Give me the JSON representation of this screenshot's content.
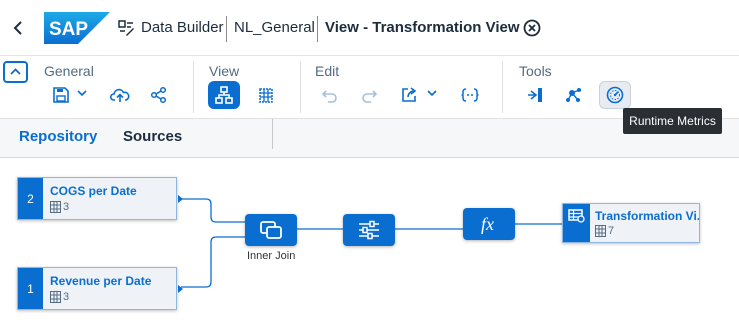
{
  "shell": {
    "logo_text": "SAP",
    "app_name": "Data Builder",
    "space_name": "NL_General",
    "view_title": "View - Transformation View"
  },
  "toolbar": {
    "groups": {
      "general": "General",
      "view": "View",
      "edit": "Edit",
      "tools": "Tools"
    },
    "tooltip": "Runtime Metrics"
  },
  "tabs": {
    "repository": "Repository",
    "sources": "Sources"
  },
  "canvas": {
    "sources": [
      {
        "number": "2",
        "title": "COGS per Date",
        "columns": "3"
      },
      {
        "number": "1",
        "title": "Revenue per Date",
        "columns": "3"
      }
    ],
    "join_label": "Inner Join",
    "output": {
      "title": "Transformation Vi...",
      "columns": "7"
    }
  },
  "colors": {
    "accent": "#0a6ed1",
    "node_bg": "#eff3f7",
    "tooltip_bg": "#2a2f33"
  }
}
